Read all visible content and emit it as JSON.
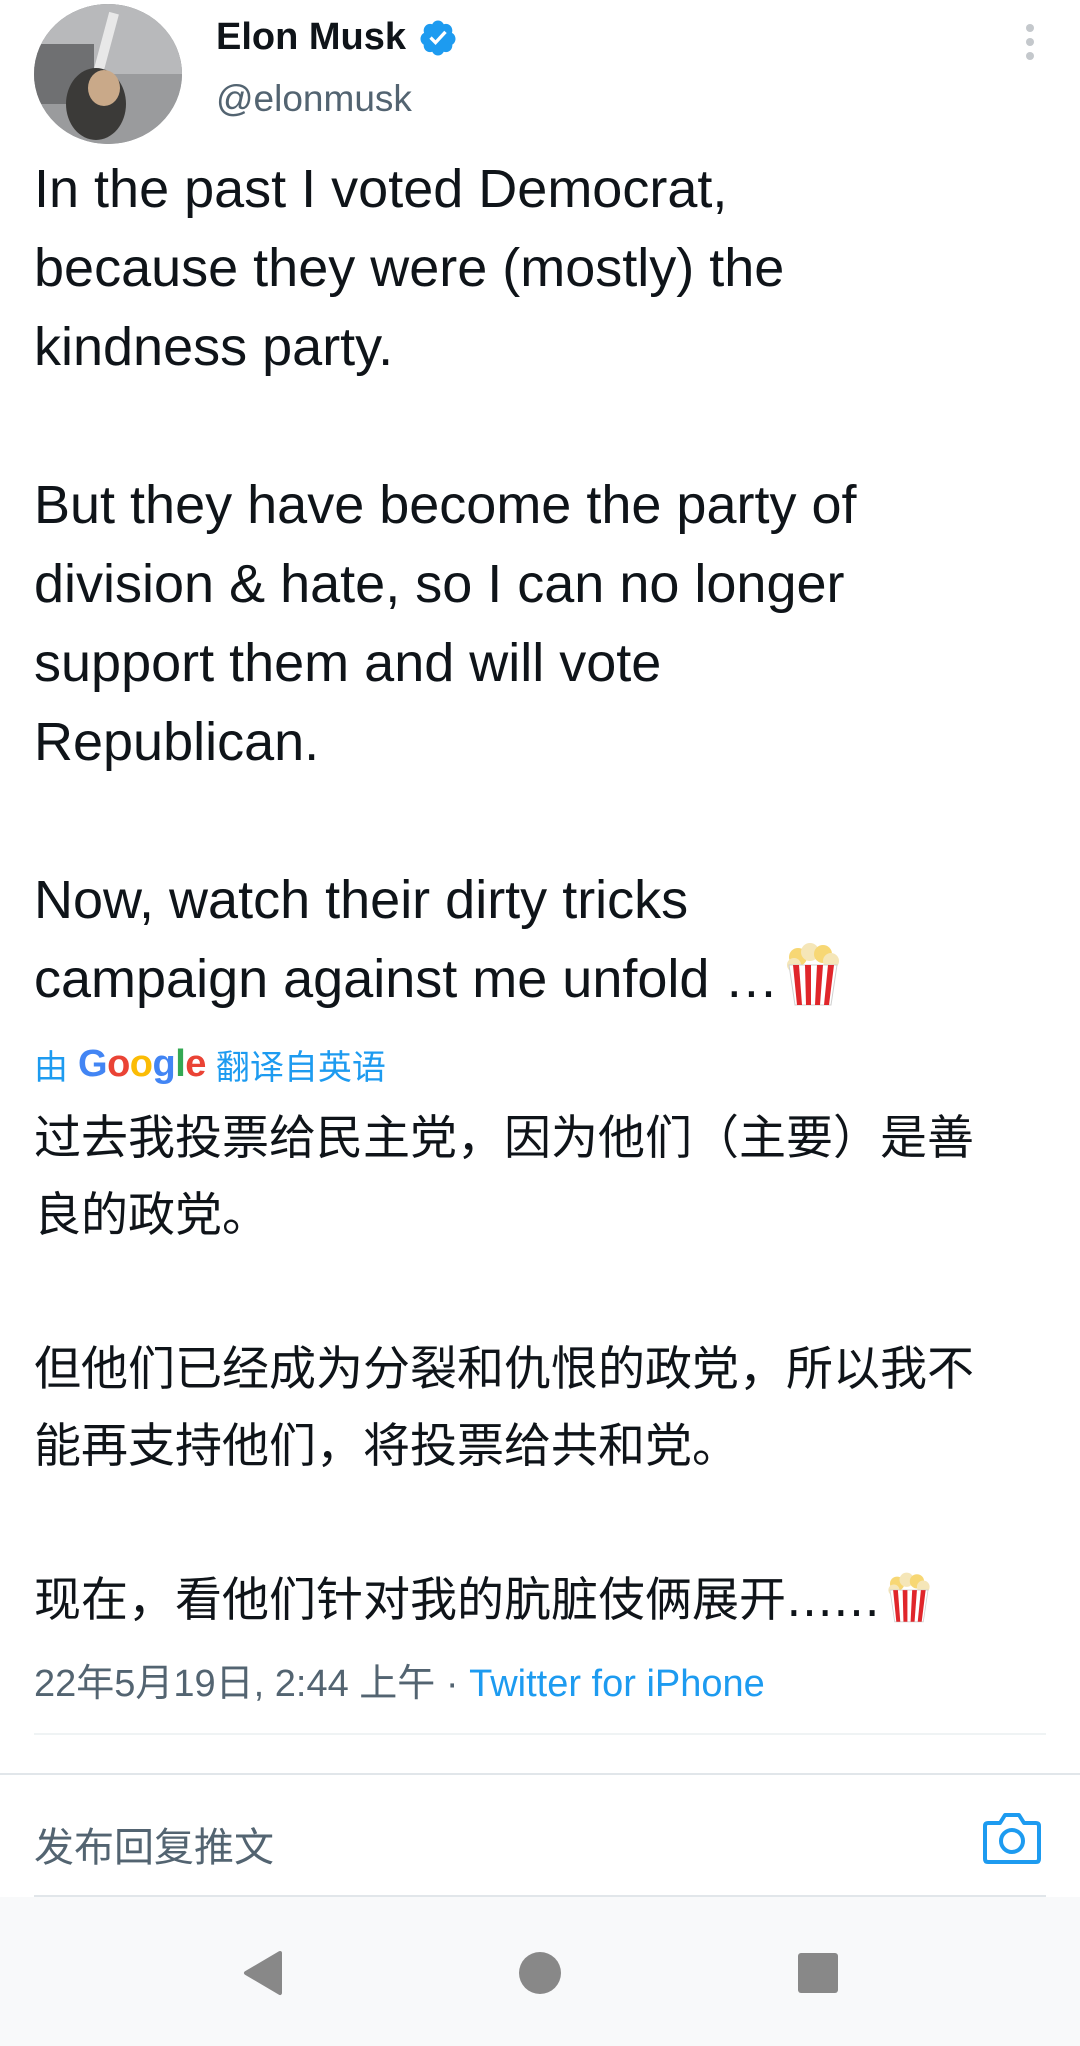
{
  "tweet": {
    "author_name": "Elon Musk",
    "author_handle": "@elonmusk",
    "text_en": "In the past I voted Democrat,\nbecause they were (mostly) the\nkindness party.\n\nBut they have become the party of\ndivision & hate, so I can no longer\nsupport them and will vote\nRepublican.\n\nNow, watch their dirty tricks\ncampaign against me unfold …",
    "translation_prefix": "由",
    "translation_brand": "Google",
    "translation_suffix": "翻译自英语",
    "text_zh": "过去我投票给民主党，因为他们（主要）是善\n良的政党。\n\n但他们已经成为分裂和仇恨的政党，所以我不\n能再支持他们，将投票给共和党。\n\n现在，看他们针对我的肮脏伎俩展开……",
    "timestamp": "22年5月19日, 2:44 上午",
    "separator": " · ",
    "source": "Twitter for iPhone"
  },
  "reply": {
    "placeholder": "发布回复推文"
  },
  "icons": {
    "verified": "verified-badge-icon",
    "more": "more-vertical-icon",
    "popcorn": "popcorn-emoji",
    "camera": "camera-icon",
    "nav_back": "nav-back-icon",
    "nav_home": "nav-home-icon",
    "nav_recent": "nav-recent-icon"
  },
  "colors": {
    "link": "#1d9bf0",
    "text": "#0f1419",
    "muted": "#536471",
    "verified": "#1d9bf0"
  }
}
